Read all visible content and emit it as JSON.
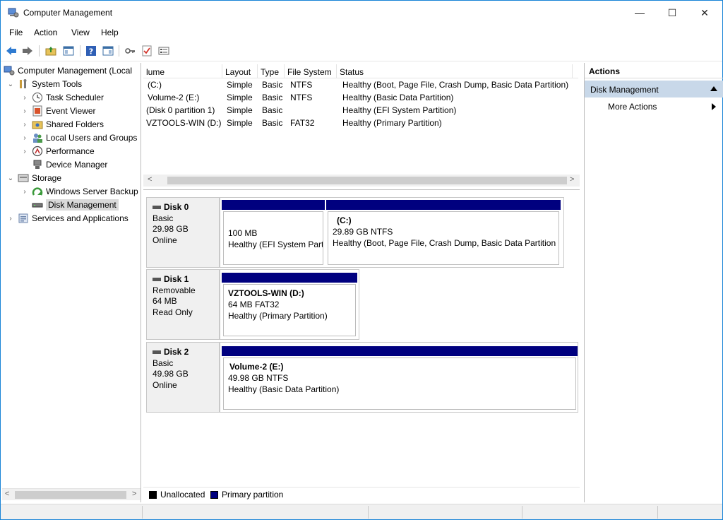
{
  "window": {
    "title": "Computer Management",
    "min_glyph": "—",
    "max_glyph": "☐",
    "close_glyph": "✕"
  },
  "menu": [
    "File",
    "Action",
    "View",
    "Help"
  ],
  "tree": {
    "items": [
      {
        "label": "Computer Management (Local",
        "icon": "computer-management-icon"
      },
      {
        "label": "System Tools",
        "icon": "tools-icon"
      },
      {
        "label": "Task Scheduler",
        "icon": "clock-icon"
      },
      {
        "label": "Event Viewer",
        "icon": "event-viewer-icon"
      },
      {
        "label": "Shared Folders",
        "icon": "shared-folder-icon"
      },
      {
        "label": "Local Users and Groups",
        "icon": "users-icon"
      },
      {
        "label": "Performance",
        "icon": "performance-icon"
      },
      {
        "label": "Device Manager",
        "icon": "device-manager-icon"
      },
      {
        "label": "Storage",
        "icon": "storage-icon"
      },
      {
        "label": "Windows Server Backup",
        "icon": "backup-icon"
      },
      {
        "label": "Disk Management",
        "icon": "disk-icon"
      },
      {
        "label": "Services and Applications",
        "icon": "services-icon"
      }
    ]
  },
  "volumes": {
    "columns": [
      "lume",
      "Layout",
      "Type",
      "File System",
      "Status"
    ],
    "rows": [
      [
        "(C:)",
        "Simple",
        "Basic",
        "NTFS",
        "Healthy (Boot, Page File, Crash Dump, Basic Data Partition)"
      ],
      [
        "Volume-2 (E:)",
        "Simple",
        "Basic",
        "NTFS",
        "Healthy (Basic Data Partition)"
      ],
      [
        "(Disk 0 partition 1)",
        "Simple",
        "Basic",
        "",
        "Healthy (EFI System Partition)"
      ],
      [
        "VZTOOLS-WIN (D:)",
        "Simple",
        "Basic",
        "FAT32",
        "Healthy (Primary Partition)"
      ]
    ]
  },
  "disks": [
    {
      "name": "Disk 0",
      "type": "Basic",
      "size": "29.98 GB",
      "state": "Online",
      "partitions": [
        {
          "name": "",
          "line1": "100 MB",
          "line2": "Healthy (EFI System Part"
        },
        {
          "name": "(C:)",
          "line1": "29.89 GB NTFS",
          "line2": "Healthy (Boot, Page File, Crash Dump, Basic Data Partition"
        }
      ]
    },
    {
      "name": "Disk 1",
      "type": "Removable",
      "size": "64 MB",
      "state": "Read Only",
      "partitions": [
        {
          "name": "VZTOOLS-WIN  (D:)",
          "line1": "64 MB FAT32",
          "line2": "Healthy (Primary Partition)"
        }
      ]
    },
    {
      "name": "Disk 2",
      "type": "Basic",
      "size": "49.98 GB",
      "state": "Online",
      "partitions": [
        {
          "name": "Volume-2  (E:)",
          "line1": "49.98 GB NTFS",
          "line2": "Healthy (Basic Data Partition)"
        }
      ]
    }
  ],
  "legend": {
    "unallocated": "Unallocated",
    "primary": "Primary partition",
    "unallocated_color": "#000000",
    "primary_color": "#00007f"
  },
  "actions": {
    "header": "Actions",
    "section": "Disk Management",
    "more": "More Actions"
  },
  "colors": {
    "accent_border": "#1883d7",
    "selection_bg": "#c8d8e9",
    "partition_bar": "#00007f"
  }
}
